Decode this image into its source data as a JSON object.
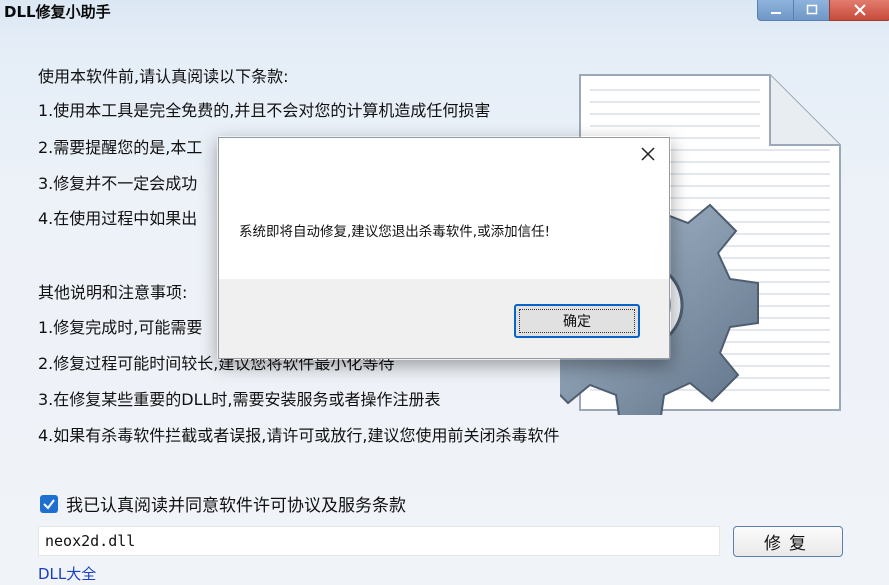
{
  "window": {
    "title": "DLL修复小助手",
    "minimize_glyph": "—",
    "maximize_glyph": "☐",
    "close_glyph": "✕"
  },
  "terms": {
    "heading": "使用本软件前,请认真阅读以下条款:",
    "items": [
      "1.使用本工具是完全免费的,并且不会对您的计算机造成任何损害",
      "2.需要提醒您的是,本工",
      "3.修复并不一定会成功",
      "4.在使用过程中如果出"
    ]
  },
  "notes": {
    "heading": "其他说明和注意事项:",
    "items": [
      "1.修复完成时,可能需要",
      "2.修复过程可能时间较长,建议您将软件最小化等待",
      "3.在修复某些重要的DLL时,需要安装服务或者操作注册表",
      "4.如果有杀毒软件拦截或者误报,请许可或放行,建议您使用前关闭杀毒软件"
    ]
  },
  "agreement": {
    "checked": true,
    "label": "我已认真阅读并同意软件许可协议及服务条款"
  },
  "dll_input": {
    "value": "neox2d.dll"
  },
  "repair_button": {
    "label": "修复"
  },
  "dll_link": {
    "label": "DLL大全"
  },
  "dialog": {
    "message": "系统即将自动修复,建议您退出杀毒软件,或添加信任!",
    "ok_label": "确定"
  },
  "colors": {
    "accent": "#1f6fd0",
    "link": "#1a3fc4",
    "close_red": "#c84a3a"
  },
  "icons": [
    "minimize-icon",
    "maximize-icon",
    "close-icon",
    "checkmark-icon",
    "document-gear-icon",
    "dialog-close-icon"
  ]
}
